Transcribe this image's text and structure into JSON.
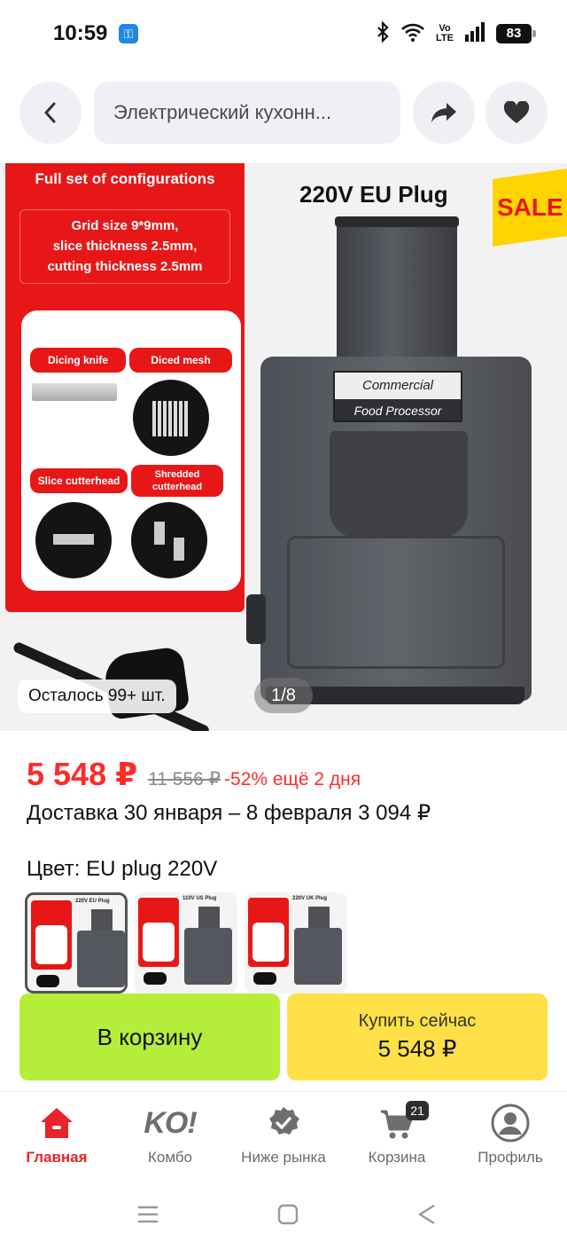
{
  "status_bar": {
    "time": "10:59",
    "battery": "83",
    "network": "Vo\nLTE"
  },
  "header": {
    "search_text": "Электрический кухонн...",
    "icons": [
      "back-arrow-icon",
      "share-icon",
      "heart-icon"
    ]
  },
  "gallery": {
    "stock_text": "Осталось 99+ шт.",
    "counter": "1/8",
    "image": {
      "panel_title": "Full set of configurations",
      "spec_lines": [
        "Grid size 9*9mm,",
        "slice thickness 2.5mm,",
        "cutting thickness 2.5mm"
      ],
      "parts": [
        "Dicing knife",
        "Diced mesh",
        "Slice cutterhead",
        "Shredded cutterhead"
      ],
      "plug_title": "220V EU Plug",
      "sale": "SALE",
      "label_line1": "Commercial",
      "label_line2": "Food Processor"
    }
  },
  "price": {
    "current": "5 548 ₽",
    "old": "11 556 ₽",
    "discount": "-52% ещё 2 дня"
  },
  "delivery": "Доставка 30 января – 8 февраля 3 094 ₽",
  "color": {
    "label": "Цвет: EU plug 220V",
    "thumbnails": [
      {
        "title": "220V EU Plug",
        "selected": true
      },
      {
        "title": "110V US Plug",
        "selected": false
      },
      {
        "title": "220V UK Plug",
        "selected": false
      }
    ]
  },
  "actions": {
    "cart_label": "В корзину",
    "buy_label": "Купить сейчас",
    "buy_price": "5 548 ₽"
  },
  "bottom_nav": {
    "items": [
      {
        "label": "Главная",
        "icon": "home-icon",
        "active": true
      },
      {
        "label": "Комбо",
        "icon": "ko-logo-icon",
        "logo_text": "KO!"
      },
      {
        "label": "Ниже рынка",
        "icon": "badge-check-icon"
      },
      {
        "label": "Корзина",
        "icon": "cart-icon",
        "badge": "21"
      },
      {
        "label": "Профиль",
        "icon": "profile-icon"
      }
    ]
  },
  "colors": {
    "price_red": "#ff2b2b",
    "cart_button": "#b4ee3a",
    "buy_button": "#ffe046",
    "nav_active": "#e8242a"
  }
}
